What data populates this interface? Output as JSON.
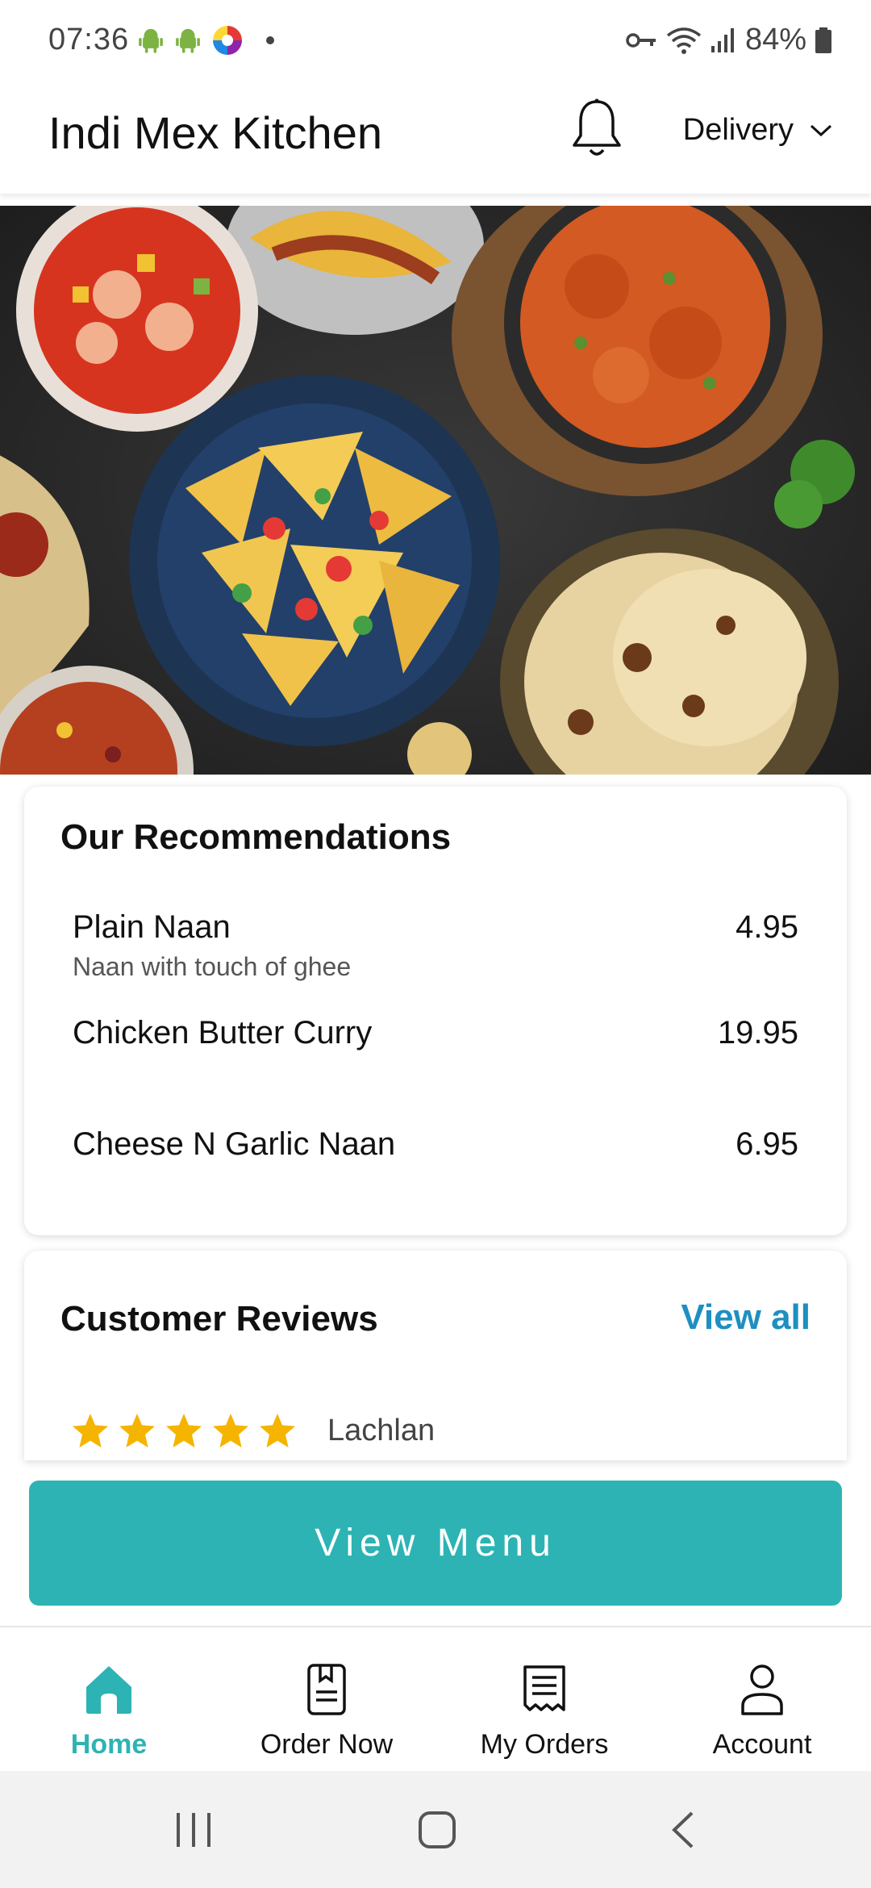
{
  "status_bar": {
    "time": "07:36",
    "battery": "84%"
  },
  "header": {
    "title": "Indi Mex Kitchen",
    "mode": "Delivery"
  },
  "recommendations": {
    "title": "Our Recommendations",
    "items": [
      {
        "name": "Plain Naan",
        "description": "Naan with touch of ghee",
        "price": "4.95"
      },
      {
        "name": "Chicken Butter Curry",
        "description": "",
        "price": "19.95"
      },
      {
        "name": "Cheese N Garlic Naan",
        "description": "",
        "price": "6.95"
      }
    ]
  },
  "reviews": {
    "title": "Customer Reviews",
    "view_all": "View all",
    "first": {
      "stars": 5,
      "name": "Lachlan"
    }
  },
  "cta": {
    "label": "View Menu"
  },
  "bottom_nav": {
    "items": [
      {
        "label": "Home",
        "icon": "home-icon",
        "active": true
      },
      {
        "label": "Order Now",
        "icon": "bookmark-doc-icon",
        "active": false
      },
      {
        "label": "My Orders",
        "icon": "receipt-icon",
        "active": false
      },
      {
        "label": "Account",
        "icon": "person-icon",
        "active": false
      }
    ]
  },
  "colors": {
    "accent": "#2db3b3",
    "link": "#1e8fc0",
    "star": "#f5b400"
  }
}
